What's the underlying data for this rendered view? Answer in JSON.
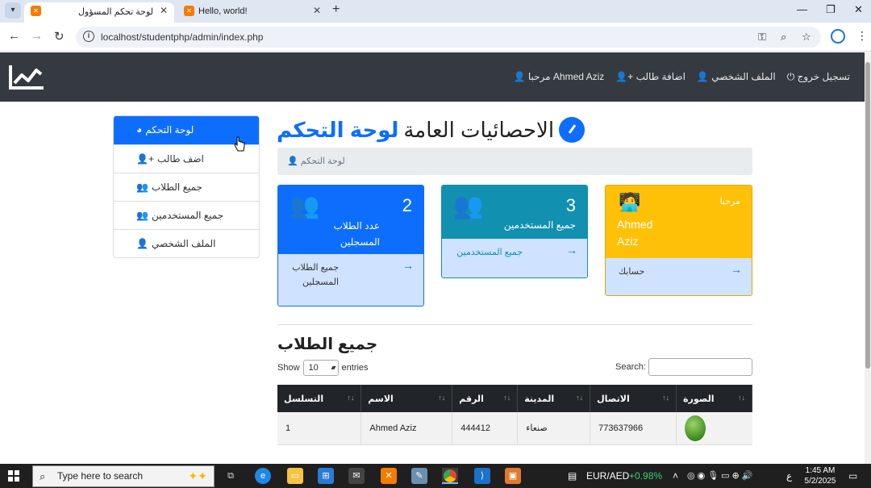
{
  "browser": {
    "tabs": [
      {
        "title": "لوحة تحكم المسؤول"
      },
      {
        "title": "Hello, world!"
      }
    ],
    "url": "localhost/studentphp/admin/index.php"
  },
  "navbar": {
    "links": [
      {
        "label": "تسجيل خروج",
        "icon": "power-icon"
      },
      {
        "label": "الملف الشخصي",
        "icon": "user-icon"
      },
      {
        "label": "اضافة طالب",
        "icon": "user-plus-icon"
      },
      {
        "label": "مرحبا Ahmed Aziz",
        "icon": "user-icon"
      }
    ]
  },
  "sidebar": {
    "items": [
      {
        "label": "لوحة التحكم",
        "icon": "dashboard-icon"
      },
      {
        "label": "اضف طالب",
        "icon": "user-plus-icon"
      },
      {
        "label": "جميع الطلاب",
        "icon": "users-icon"
      },
      {
        "label": "جميع المستخدمين",
        "icon": "users-icon"
      },
      {
        "label": "الملف الشخصي",
        "icon": "user-icon"
      }
    ]
  },
  "header": {
    "title_blue": "لوحة التحكم",
    "title_rest": "الاحصائيات العامة",
    "breadcrumb": "لوحة التحكم"
  },
  "cards": {
    "students": {
      "count": "2",
      "caption_line1": "عدد الطلاب",
      "caption_line2": "المسجلين",
      "link_line1": "جميع الطلاب",
      "link_line2": "المسجلين"
    },
    "users": {
      "count": "3",
      "caption": "جميع المستخدمين",
      "link": "جميع المستخدمين"
    },
    "welcome": {
      "greeting": "مرحبا",
      "name_line1": "Ahmed",
      "name_line2": "Aziz",
      "link": "حسابك"
    }
  },
  "students_table": {
    "title": "جميع الطلاب",
    "show_label": "Show",
    "entries_value": "10",
    "entries_label": "entries",
    "search_label": "Search:",
    "columns": [
      "التسلسل",
      "الاسم",
      "الرقم",
      "المدينة",
      "الاتصال",
      "الصورة"
    ],
    "rows": [
      {
        "seq": "1",
        "name": "Ahmed Aziz",
        "number": "444412",
        "city": "صنعاء",
        "contact": "773637966"
      }
    ]
  },
  "taskbar": {
    "search_placeholder": "Type here to search",
    "currency": "EUR/AED",
    "currency_change": "+0.98%",
    "lang": "ع",
    "time": "1:45 AM",
    "date": "5/2/2025"
  },
  "colors": {
    "primary": "#0d6efd",
    "info": "#1190b0",
    "warning": "#ffc107",
    "dark": "#343a40"
  }
}
